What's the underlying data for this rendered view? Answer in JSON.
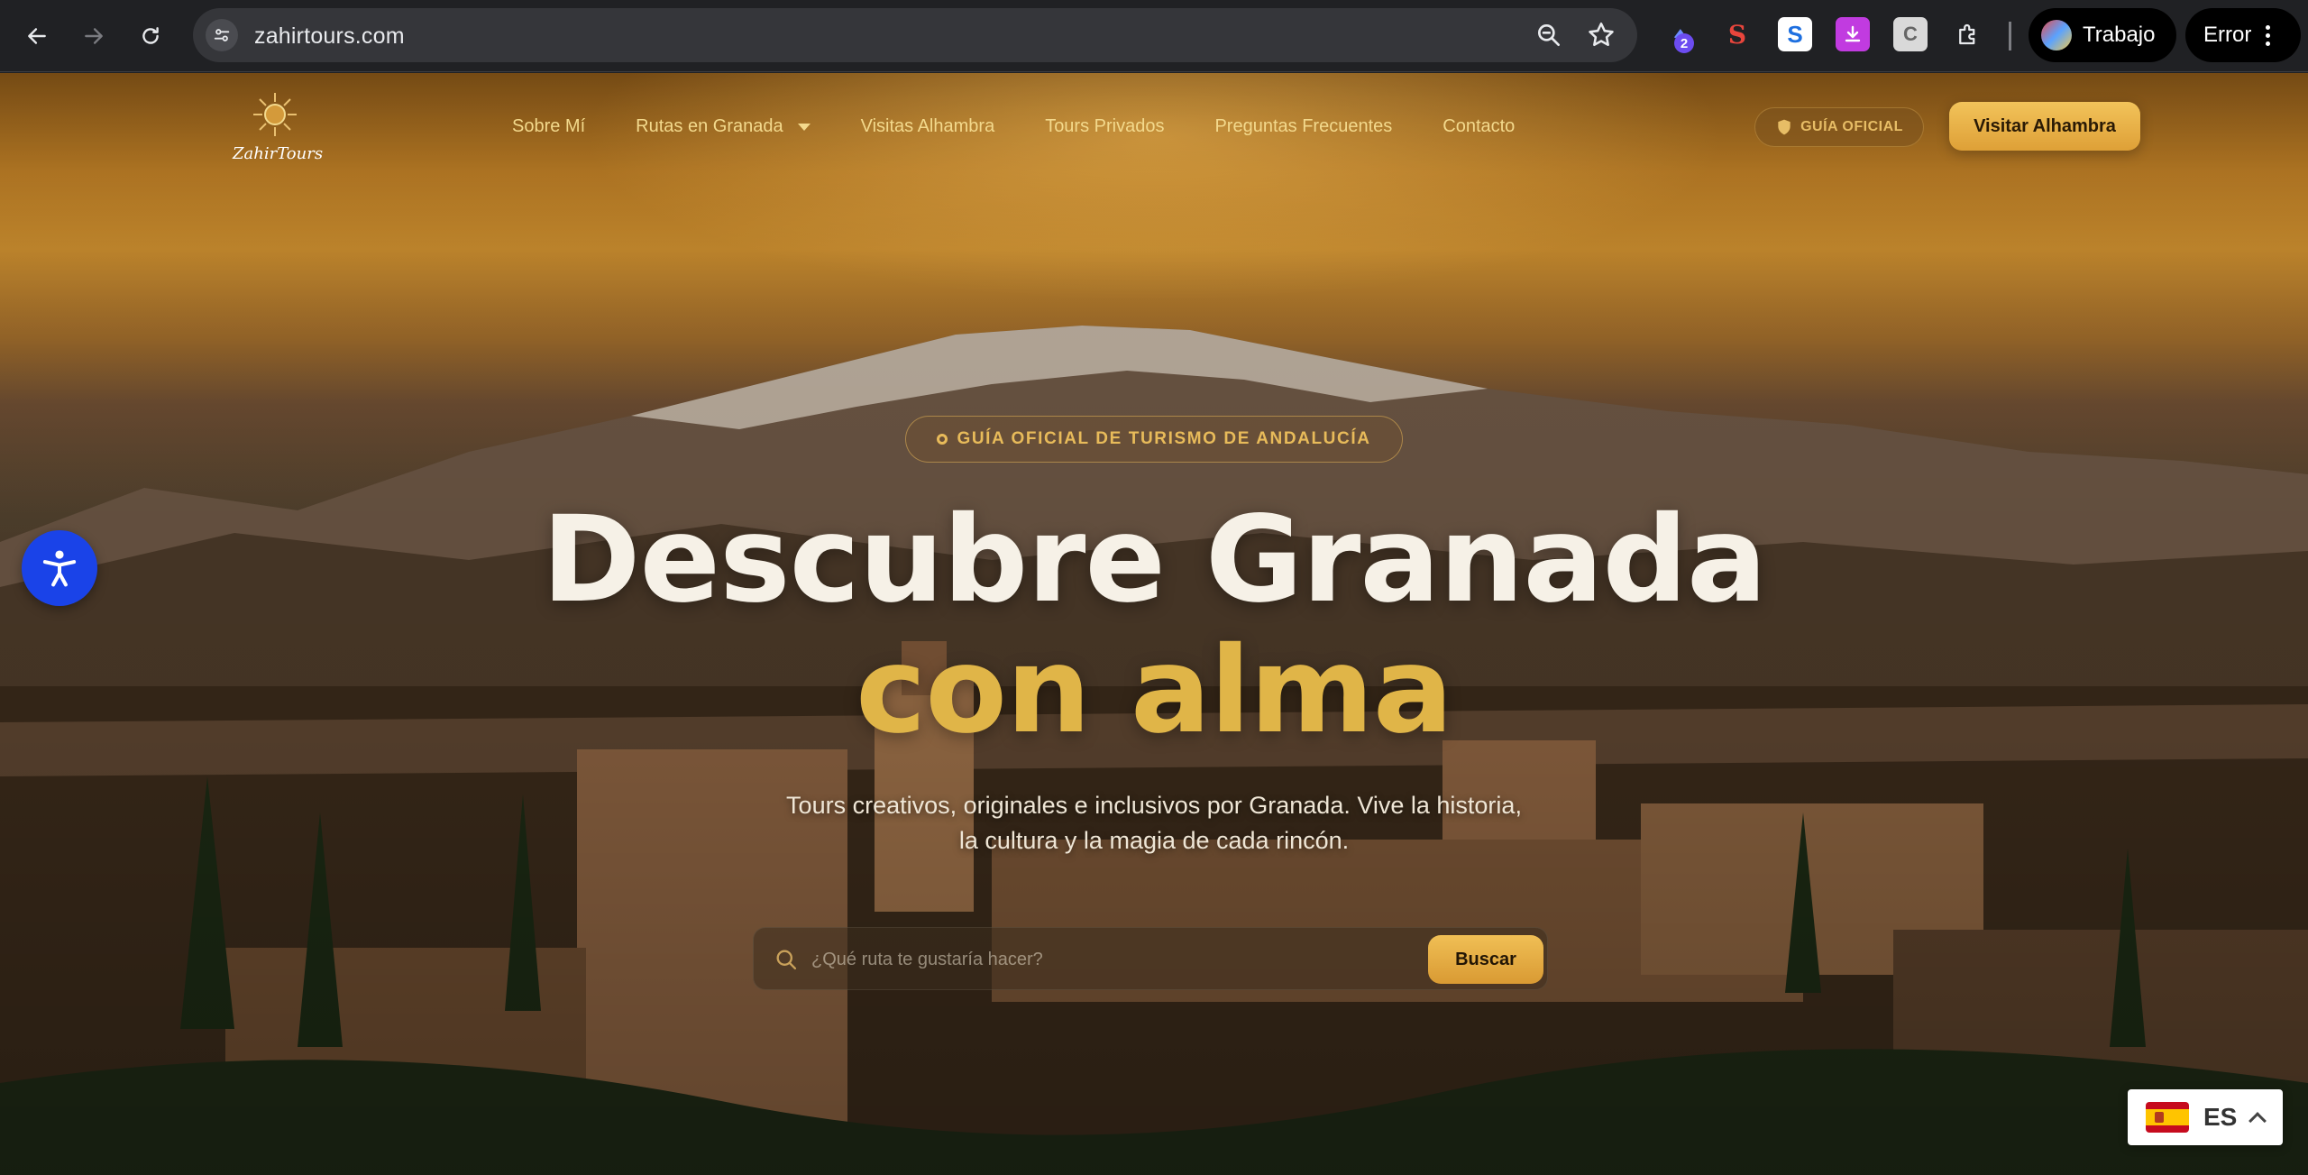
{
  "browser": {
    "url": "zahirtours.com",
    "extension_badge": "2",
    "profile_label": "Trabajo",
    "error_label": "Error"
  },
  "site": {
    "logo_text": "ZahirTours",
    "nav": [
      {
        "label": "Sobre Mí"
      },
      {
        "label": "Rutas en Granada",
        "has_dropdown": true
      },
      {
        "label": "Visitas Alhambra"
      },
      {
        "label": "Tours Privados"
      },
      {
        "label": "Preguntas Frecuentes"
      },
      {
        "label": "Contacto"
      }
    ],
    "official_badge": "GUÍA OFICIAL",
    "cta_label": "Visitar Alhambra"
  },
  "hero": {
    "kicker": "GUÍA OFICIAL DE TURISMO DE ANDALUCÍA",
    "headline_line1": "Descubre Granada",
    "headline_line2": "con alma",
    "subtitle_line1": "Tours creativos, originales e inclusivos por Granada. Vive la historia,",
    "subtitle_line2": "la cultura y la magia de cada rincón.",
    "search_placeholder": "¿Qué ruta te gustaría hacer?",
    "search_button": "Buscar"
  },
  "language": {
    "code": "ES"
  },
  "colors": {
    "accent_gold": "#e0b548",
    "cta_gold": "#f0bf55",
    "a11y_blue": "#1a43e8"
  }
}
